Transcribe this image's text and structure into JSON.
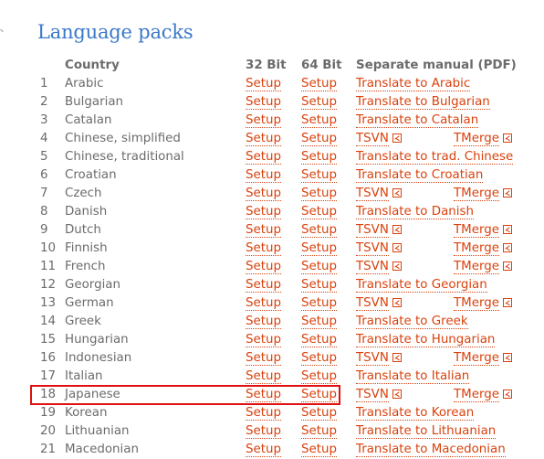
{
  "title": "Language packs",
  "header": {
    "country": "Country",
    "b32": "32 Bit",
    "b64": "64 Bit",
    "manual": "Separate manual (PDF)"
  },
  "setup_label": "Setup",
  "pdf_icon": "pdf-icon",
  "accent_color": "#d8420e",
  "highlight_color": "#e01010",
  "highlighted_row": "18",
  "rows": [
    {
      "num": "1",
      "country": "Arabic",
      "manual": "Translate to Arabic"
    },
    {
      "num": "2",
      "country": "Bulgarian",
      "manual": "Translate to Bulgarian"
    },
    {
      "num": "3",
      "country": "Catalan",
      "manual": "Translate to Catalan"
    },
    {
      "num": "4",
      "country": "Chinese, simplified",
      "tsvn": "TSVN",
      "tmerge": "TMerge"
    },
    {
      "num": "5",
      "country": "Chinese, traditional",
      "manual": "Translate to trad. Chinese"
    },
    {
      "num": "6",
      "country": "Croatian",
      "manual": "Translate to Croatian"
    },
    {
      "num": "7",
      "country": "Czech",
      "tsvn": "TSVN",
      "tmerge": "TMerge"
    },
    {
      "num": "8",
      "country": "Danish",
      "manual": "Translate to Danish"
    },
    {
      "num": "9",
      "country": "Dutch",
      "tsvn": "TSVN",
      "tmerge": "TMerge"
    },
    {
      "num": "10",
      "country": "Finnish",
      "tsvn": "TSVN",
      "tmerge": "TMerge"
    },
    {
      "num": "11",
      "country": "French",
      "tsvn": "TSVN",
      "tmerge": "TMerge"
    },
    {
      "num": "12",
      "country": "Georgian",
      "manual": "Translate to Georgian"
    },
    {
      "num": "13",
      "country": "German",
      "tsvn": "TSVN",
      "tmerge": "TMerge"
    },
    {
      "num": "14",
      "country": "Greek",
      "manual": "Translate to Greek"
    },
    {
      "num": "15",
      "country": "Hungarian",
      "manual": "Translate to Hungarian"
    },
    {
      "num": "16",
      "country": "Indonesian",
      "tsvn": "TSVN",
      "tmerge": "TMerge"
    },
    {
      "num": "17",
      "country": "Italian",
      "manual": "Translate to Italian"
    },
    {
      "num": "18",
      "country": "Japanese",
      "tsvn": "TSVN",
      "tmerge": "TMerge"
    },
    {
      "num": "19",
      "country": "Korean",
      "manual": "Translate to Korean"
    },
    {
      "num": "20",
      "country": "Lithuanian",
      "manual": "Translate to Lithuanian"
    },
    {
      "num": "21",
      "country": "Macedonian",
      "manual": "Translate to Macedonian"
    }
  ]
}
